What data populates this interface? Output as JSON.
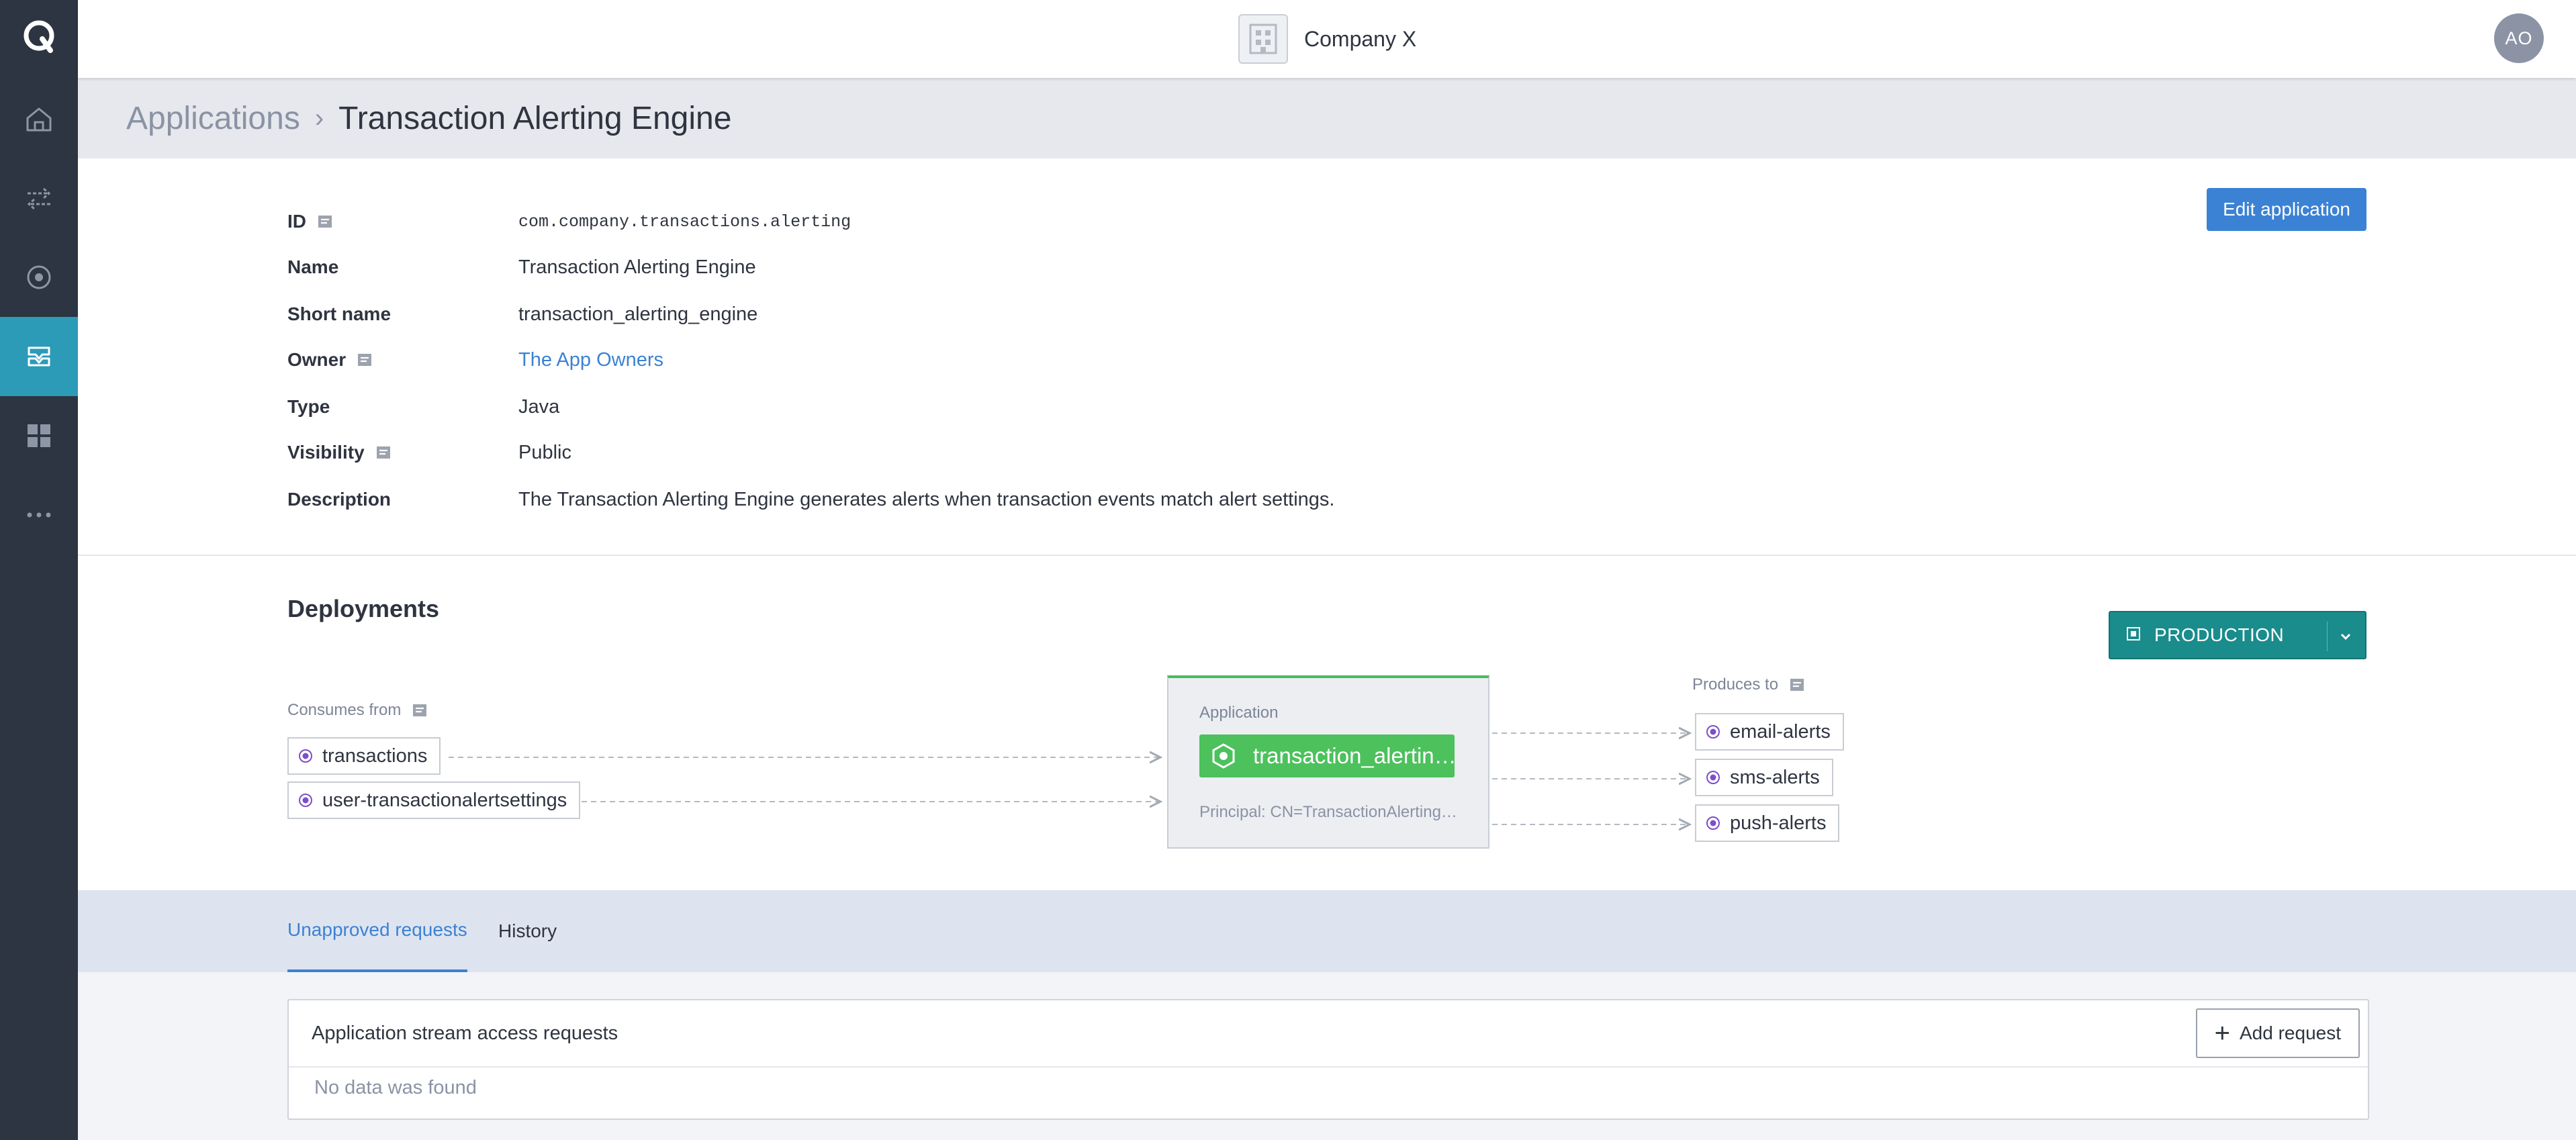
{
  "header": {
    "company_name": "Company X",
    "user_initials": "AO"
  },
  "sidebar": {
    "items": [
      {
        "name": "home",
        "icon": "home-icon"
      },
      {
        "name": "streams",
        "icon": "arrows-icon"
      },
      {
        "name": "topics",
        "icon": "target-icon"
      },
      {
        "name": "applications",
        "icon": "applications-icon",
        "active": true
      },
      {
        "name": "dashboards",
        "icon": "grid-icon"
      },
      {
        "name": "more",
        "icon": "more-icon"
      }
    ]
  },
  "breadcrumb": {
    "parent": "Applications",
    "separator": "›",
    "current": "Transaction Alerting Engine"
  },
  "details": {
    "edit_label": "Edit application",
    "rows": [
      {
        "label": "ID",
        "value": "com.company.transactions.alerting"
      },
      {
        "label": "Name",
        "value": "Transaction Alerting Engine"
      },
      {
        "label": "Short name",
        "value": "transaction_alerting_engine"
      },
      {
        "label": "Owner",
        "value": "The App Owners"
      },
      {
        "label": "Type",
        "value": "Java"
      },
      {
        "label": "Visibility",
        "value": "Public"
      },
      {
        "label": "Description",
        "value": "The Transaction Alerting Engine generates alerts when transaction events match alert settings."
      }
    ]
  },
  "deployments": {
    "title": "Deployments",
    "environment": "PRODUCTION",
    "consumes_label": "Consumes from",
    "produces_label": "Produces to",
    "consumes": [
      "transactions",
      "user-transactionalertsettings"
    ],
    "produces": [
      "email-alerts",
      "sms-alerts",
      "push-alerts"
    ],
    "app": {
      "caption": "Application",
      "name": "transaction_alertin…",
      "principal": "Principal: CN=TransactionAlerting…"
    }
  },
  "tabs": [
    {
      "label": "Unapproved requests",
      "active": true
    },
    {
      "label": "History",
      "active": false
    }
  ],
  "requests": {
    "title": "Application stream access requests",
    "add_label": "Add request",
    "empty": "No data was found"
  },
  "colors": {
    "sidebar": "#2c3541",
    "sidebar_active": "#2b9bb8",
    "primary": "#3b82d4",
    "environment": "#1a8c8c",
    "app_green": "#4cc15c",
    "topic_dot": "#7b4fc9"
  }
}
